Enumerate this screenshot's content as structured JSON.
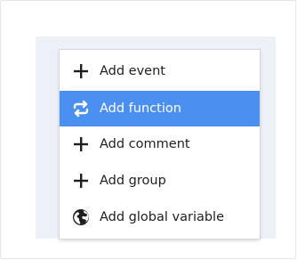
{
  "menu": {
    "items": [
      {
        "label": "Add event",
        "icon": "plus-icon",
        "active": false
      },
      {
        "label": "Add function",
        "icon": "repeat-icon",
        "active": true
      },
      {
        "label": "Add comment",
        "icon": "plus-icon",
        "active": false
      },
      {
        "label": "Add group",
        "icon": "plus-icon",
        "active": false
      },
      {
        "label": "Add global variable",
        "icon": "globe-icon",
        "active": false
      }
    ]
  },
  "colors": {
    "accent": "#4b8ff0",
    "backdrop": "#eef0f7",
    "text": "#1f1f1f"
  }
}
